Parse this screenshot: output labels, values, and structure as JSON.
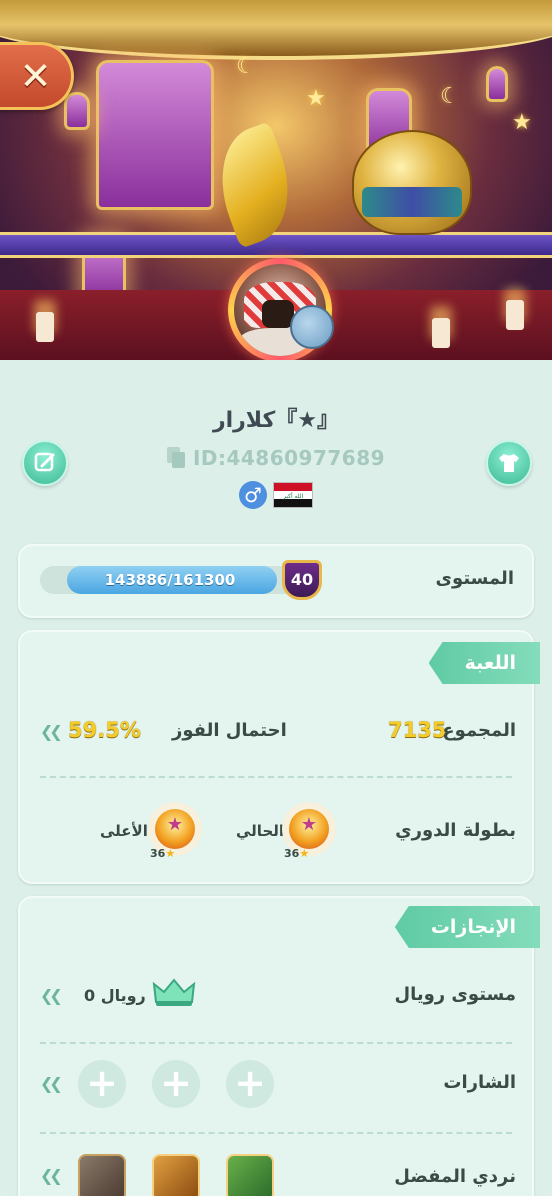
{
  "header": {
    "close_label": "✕"
  },
  "profile": {
    "nickname": "ﮐﻼرار『★』",
    "user_id": "ID:44860977689",
    "gender_symbol": "♂",
    "country_flag": "iraq-flag-icon"
  },
  "level": {
    "label": "المستوى",
    "progress_text": "143886/161300",
    "current": 143886,
    "max": 161300,
    "level_number": "40"
  },
  "game": {
    "section_title": "اللعبة",
    "total_label": "المجموع",
    "total_value": "7135",
    "win_rate_label": "احتمال الفوز",
    "win_rate_value": "59.5%",
    "league_label": "بطولة الدوري",
    "current_label": "الحالي",
    "current_count": "36",
    "highest_label": "الأعلى",
    "highest_count": "36"
  },
  "achievements": {
    "section_title": "الإنجازات",
    "royal_label": "مستوى رويال",
    "royal_value": "رويال 0",
    "badges_label": "الشارات",
    "badge_slots": [
      "+",
      "+",
      "+"
    ],
    "favorite_dice_label": "نردي المفضل"
  },
  "colors": {
    "accent": "#5fcba4",
    "gold": "#f4cc2a",
    "progress": "#4aa6e2",
    "background": "#dcefe8"
  },
  "icons": [
    "close-icon",
    "edit-icon",
    "shirt-icon",
    "copy-icon",
    "male-icon",
    "iraq-flag-icon",
    "crown-icon",
    "plus-icon",
    "dice-icon",
    "chevron-left-icon",
    "league-medal-icon"
  ]
}
